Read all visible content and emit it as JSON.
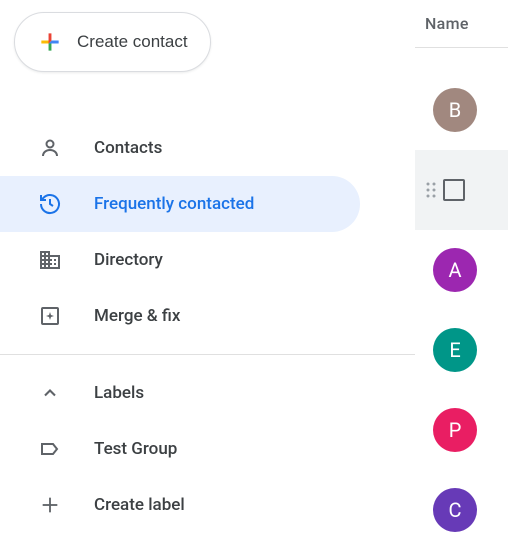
{
  "create": {
    "label": "Create contact"
  },
  "nav": {
    "contacts": "Contacts",
    "frequent": "Frequently contacted",
    "directory": "Directory",
    "merge": "Merge & fix",
    "labels": "Labels",
    "test_group": "Test Group",
    "create_label": "Create label"
  },
  "header": {
    "name": "Name"
  },
  "contacts": [
    {
      "initial": "B",
      "color": "#a1887f"
    },
    {
      "initial": "",
      "color": "",
      "selected": true
    },
    {
      "initial": "A",
      "color": "#9c27b0"
    },
    {
      "initial": "E",
      "color": "#009688"
    },
    {
      "initial": "P",
      "color": "#e91e63"
    },
    {
      "initial": "C",
      "color": "#673ab7"
    }
  ]
}
